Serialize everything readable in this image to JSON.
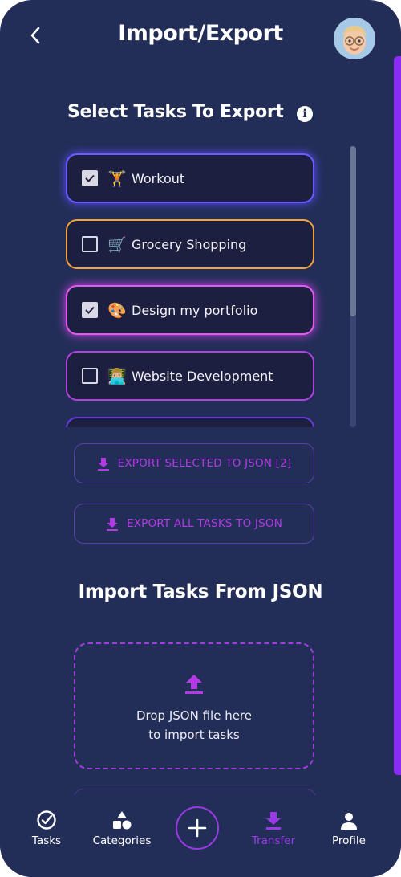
{
  "header": {
    "title": "Import/Export",
    "back_icon": "chevron-left-icon",
    "avatar_icon": "memoji-avatar"
  },
  "export_section": {
    "title": "Select Tasks To Export",
    "info_icon": "info-icon",
    "tasks": [
      {
        "emoji": "🏋️",
        "label": "Workout",
        "checked": true,
        "color": "#6a5cff"
      },
      {
        "emoji": "🛒",
        "label": "Grocery Shopping",
        "checked": false,
        "color": "#f2a43a"
      },
      {
        "emoji": "🎨",
        "label": "Design my portfolio",
        "checked": true,
        "color": "#e35af0"
      },
      {
        "emoji": "👨🏼‍💻",
        "label": "Website Development",
        "checked": false,
        "color": "#b23fe0"
      },
      {
        "emoji": "",
        "label": "",
        "checked": false,
        "color": "#6a3bd8"
      }
    ],
    "export_selected_label": "EXPORT SELECTED TO JSON [2]",
    "export_all_label": "EXPORT ALL TASKS TO JSON"
  },
  "import_section": {
    "title": "Import Tasks From JSON",
    "drop_line1": "Drop JSON file here",
    "drop_line2": "to import tasks"
  },
  "nav": {
    "tasks": "Tasks",
    "categories": "Categories",
    "add_icon": "plus-icon",
    "transfer": "Transfer",
    "profile": "Profile",
    "active": "Transfer"
  },
  "colors": {
    "background": "#232e58",
    "accent": "#9a3ae6",
    "card": "#1c1f3f"
  }
}
